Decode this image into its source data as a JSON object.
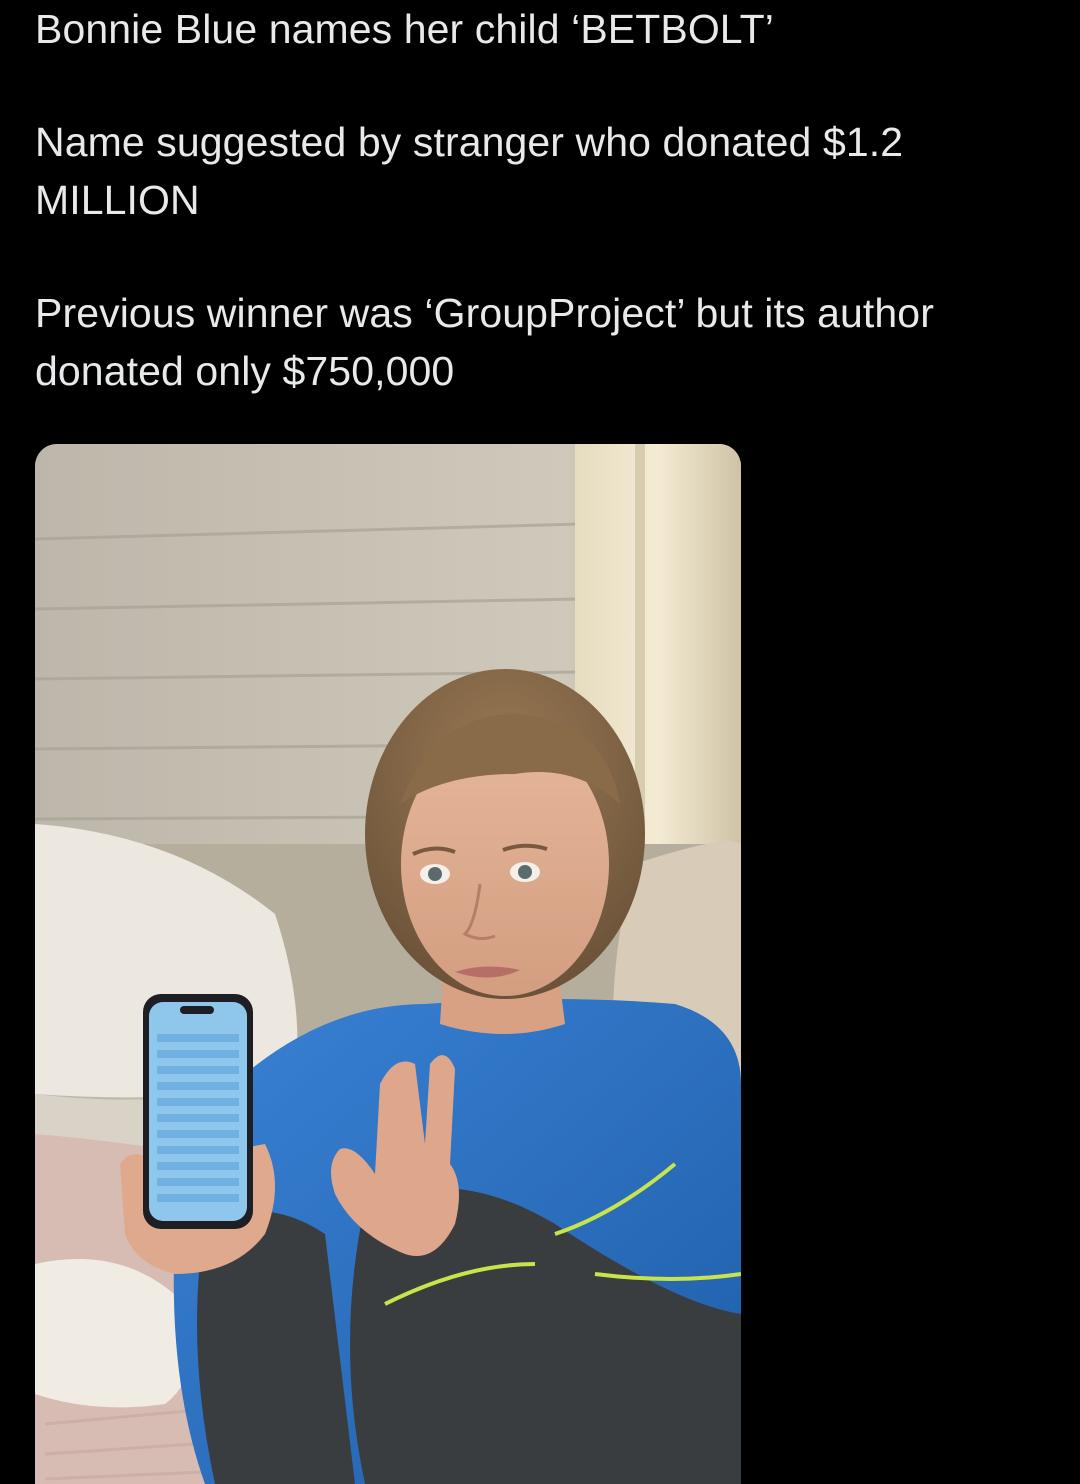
{
  "tweet": {
    "paragraphs": [
      "Bonnie Blue names her child ‘BETBOLT’",
      "Name suggested by stranger who donated $1.2 MILLION",
      "Previous winner was ‘GroupProject’ but its author donated only $750,000"
    ]
  },
  "media": {
    "type": "photo",
    "icon": "photo-icon"
  },
  "colors": {
    "background": "#000000",
    "text": "#e7e9ea",
    "fleece": "#2f73c9",
    "phone_screen": "#8fc6ec"
  }
}
